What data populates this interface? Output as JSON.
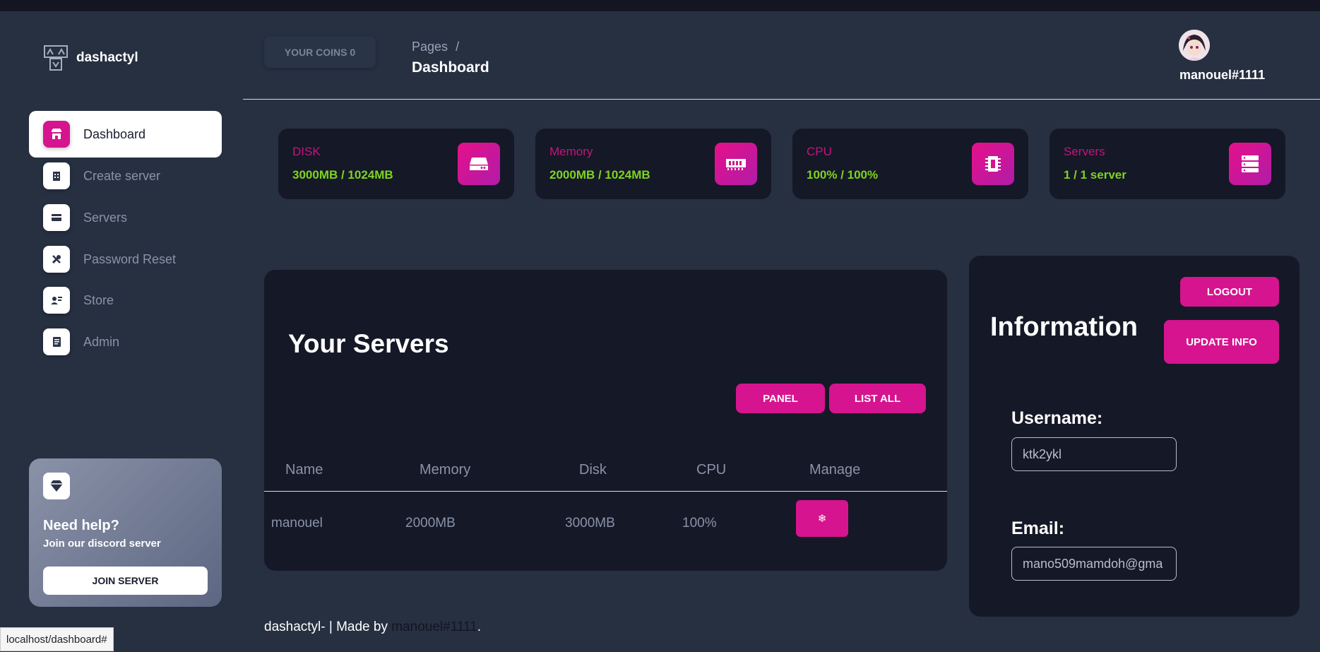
{
  "brand": {
    "name": "dashactyl"
  },
  "sidebar": {
    "items": [
      {
        "label": "Dashboard",
        "icon": "shop-icon",
        "active": true
      },
      {
        "label": "Create server",
        "icon": "building-icon",
        "active": false
      },
      {
        "label": "Servers",
        "icon": "credit-card-icon",
        "active": false
      },
      {
        "label": "Password Reset",
        "icon": "tools-icon",
        "active": false
      },
      {
        "label": "Store",
        "icon": "user-card-icon",
        "active": false
      },
      {
        "label": "Admin",
        "icon": "document-icon",
        "active": false
      }
    ],
    "help": {
      "title": "Need help?",
      "subtitle": "Join our discord server",
      "button": "JOIN SERVER",
      "icon": "diamond-icon"
    }
  },
  "header": {
    "coins_label": "YOUR COINS 0",
    "breadcrumb_root": "Pages",
    "breadcrumb_sep": "/",
    "title": "Dashboard",
    "username": "manouel#1111"
  },
  "stats": [
    {
      "label": "DISK",
      "value": "3000MB / 1024MB",
      "icon": "hard-drive-icon"
    },
    {
      "label": "Memory",
      "value": "2000MB / 1024MB",
      "icon": "memory-icon"
    },
    {
      "label": "CPU",
      "value": "100% / 100%",
      "icon": "cpu-icon"
    },
    {
      "label": "Servers",
      "value": "1 / 1 server",
      "icon": "server-stack-icon"
    }
  ],
  "servers": {
    "title": "Your Servers",
    "panel_button": "PANEL",
    "list_all_button": "LIST ALL",
    "columns": [
      "Name",
      "Memory",
      "Disk",
      "CPU",
      "Manage"
    ],
    "rows": [
      {
        "name": "manouel",
        "memory": "2000MB",
        "disk": "3000MB",
        "cpu": "100%",
        "manage_icon": "gear-icon",
        "manage_glyph": "❄"
      }
    ]
  },
  "info": {
    "title": "Information",
    "logout_button": "LOGOUT",
    "update_button": "UPDATE INFO",
    "username_label": "Username:",
    "username_value": "ktk2ykl",
    "email_label": "Email:",
    "email_value": "mano509mamdoh@gma"
  },
  "footer": {
    "prefix": "dashactyl- | Made by ",
    "author": "manouel#1111",
    "suffix": "."
  },
  "statusbar": {
    "url": "localhost/dashboard#"
  },
  "colors": {
    "accent": "#d6148f",
    "stat_label": "#c2157f",
    "stat_value": "#7ed321",
    "background": "#263041",
    "card": "#151826"
  }
}
